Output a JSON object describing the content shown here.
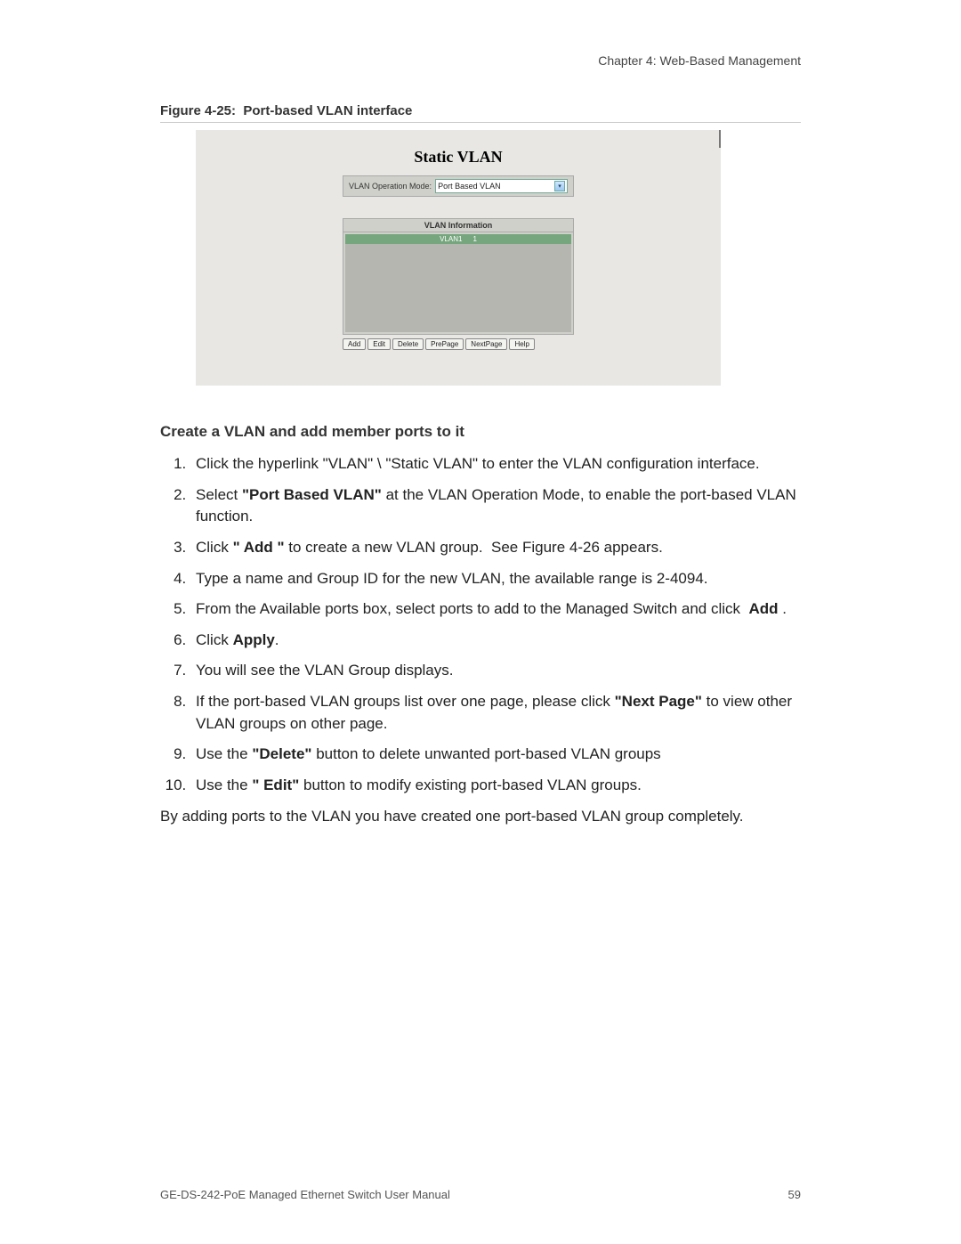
{
  "header": {
    "chapter_line": "Chapter 4: Web-Based Management"
  },
  "figure": {
    "caption": "Figure 4-25:  Port-based VLAN interface",
    "title": "Static VLAN",
    "mode_label": "VLAN Operation Mode:",
    "mode_value": "Port Based VLAN",
    "info_title": "VLAN Information",
    "vlan_row_name": "VLAN1",
    "vlan_row_id": "1",
    "buttons": {
      "add": "Add",
      "edit": "Edit",
      "delete": "Delete",
      "prepage": "PrePage",
      "nextpage": "NextPage",
      "help": "Help"
    }
  },
  "section": {
    "heading": "Create a VLAN and add member ports to it"
  },
  "steps": {
    "s1": "Click the hyperlink \"VLAN\" \\ \"Static VLAN\" to enter the VLAN configuration interface.",
    "s2_a": "Select ",
    "s2_b": "\"Port Based VLAN\"",
    "s2_c": " at the VLAN Operation Mode, to enable the port-based VLAN function.",
    "s3_a": "Click ",
    "s3_b": "\" Add \"",
    "s3_c": " to create a new VLAN group.  See Figure 4-26 appears.",
    "s4": "Type a name and Group ID for the new VLAN, the available range is 2-4094.",
    "s5_a": "From the Available ports box, select ports to add to the Managed Switch and click  ",
    "s5_b": "Add",
    "s5_c": " .",
    "s6_a": "Click ",
    "s6_b": "Apply",
    "s6_c": ".",
    "s7": "You will see the VLAN Group displays.",
    "s8_a": "If the port-based VLAN groups list over one page, please click ",
    "s8_b": "\"Next Page\"",
    "s8_c": " to view other VLAN groups on other page.",
    "s9_a": "Use the ",
    "s9_b": "\"Delete\"",
    "s9_c": " button to delete unwanted port-based VLAN groups",
    "s10_a": "Use the ",
    "s10_b": "\" Edit\"",
    "s10_c": " button to modify existing port-based VLAN groups."
  },
  "closing": "By adding ports to the VLAN you have created one port-based VLAN group completely.",
  "footer": {
    "manual": "GE-DS-242-PoE Managed Ethernet Switch User Manual",
    "page": "59"
  }
}
